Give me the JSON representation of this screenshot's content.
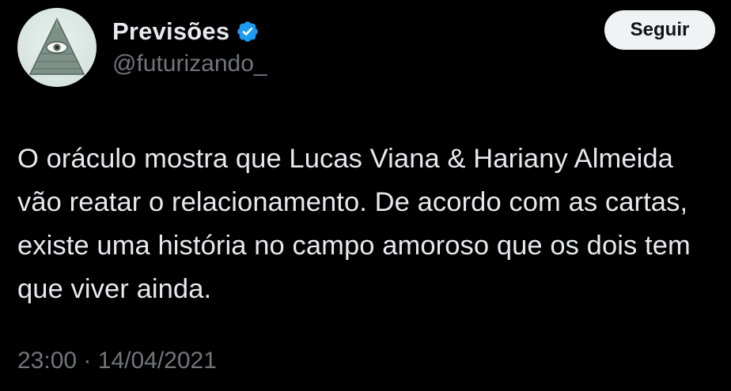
{
  "author": {
    "display_name": "Previsões",
    "handle": "@futurizando_",
    "verified": true,
    "verified_color": "#1d9bf0",
    "avatar_icon": "eye-of-providence-pyramid"
  },
  "actions": {
    "follow_label": "Seguir"
  },
  "tweet": {
    "text": "O oráculo mostra que Lucas Viana & Hariany Almeida vão reatar o relacionamento. De acordo com as cartas, existe uma história no campo amoroso que os dois tem que viver ainda.",
    "time": "23:00",
    "separator": "·",
    "date": "14/04/2021"
  },
  "colors": {
    "background": "#000000",
    "primary_text": "#e7e9ea",
    "secondary_text": "#71767b",
    "button_bg": "#eff3f4"
  }
}
